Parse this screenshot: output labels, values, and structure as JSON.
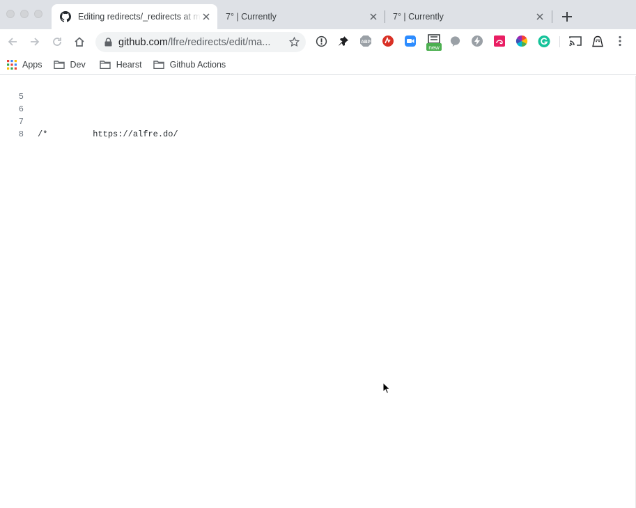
{
  "tabs": [
    {
      "title": "Editing redirects/_redirects at master",
      "favicon": "github-icon",
      "active": true
    },
    {
      "title": "7° | Currently",
      "active": false
    },
    {
      "title": "7° | Currently",
      "active": false
    }
  ],
  "omnibox": {
    "url_host": "github.com",
    "url_path": "/lfre/redirects/edit/ma..."
  },
  "extensions": [
    "info-icon",
    "pin-icon",
    "abp-icon",
    "red-ext-icon",
    "zoom-icon",
    "new-ext-icon",
    "chat-bubble-icon",
    "bolt-icon",
    "pink-ext-icon",
    "color-wheel-icon",
    "grammarly-icon",
    "cast-icon",
    "profile-icon",
    "menu-icon"
  ],
  "extension_badge": "new",
  "bookmarks": [
    {
      "label": "Apps",
      "icon": "apps-grid-icon"
    },
    {
      "label": "Dev",
      "icon": "folder-icon"
    },
    {
      "label": "Hearst",
      "icon": "folder-icon"
    },
    {
      "label": "Github Actions",
      "icon": "folder-icon"
    }
  ],
  "editor": {
    "lines": [
      {
        "number": "5",
        "text": ""
      },
      {
        "number": "6",
        "text": ""
      },
      {
        "number": "7",
        "text": "/*         https://alfre.do/"
      },
      {
        "number": "8",
        "text": ""
      }
    ]
  },
  "colors": {
    "tabstrip_bg": "#dee1e6",
    "omnibox_bg": "#f1f3f4",
    "line_number": "#6a737d"
  }
}
